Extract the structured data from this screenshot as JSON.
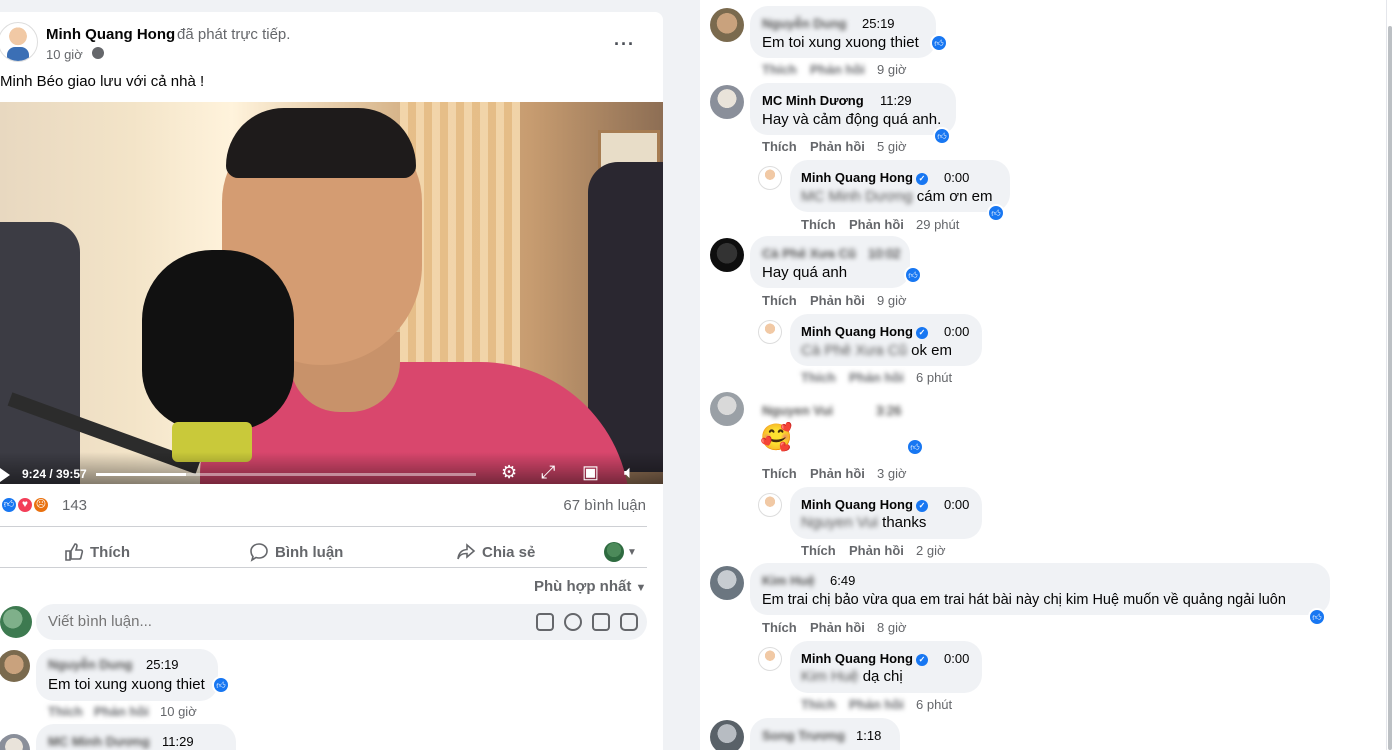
{
  "post": {
    "author": "Minh Quang Hong",
    "action": "đã phát trực tiếp.",
    "time": "10 giờ",
    "text": "Minh Béo giao lưu với cả nhà !",
    "video": {
      "time_label": "9:24 / 39:57",
      "progress": 0.236
    },
    "reactions_count": "143",
    "comments_count": "67 bình luận",
    "actions": {
      "like": "Thích",
      "comment": "Bình luận",
      "share": "Chia sẻ"
    },
    "sort_label": "Phù hợp nhất",
    "composer_placeholder": "Viết bình luận..."
  },
  "left_comments": [
    {
      "name": "Nguyễn Dung",
      "time": "25:19",
      "text": "Em toi xung xuong thiet",
      "like": "Thích",
      "reply": "Phản hồi",
      "age": "10 giờ"
    },
    {
      "name": "MC Minh Dương",
      "time": "11:29"
    }
  ],
  "right_comments": [
    {
      "name": "Nguyễn Dung",
      "time": "25:19",
      "text": "Em toi xung xuong thiet",
      "like": "Thích",
      "reply": "Phản hồi",
      "age": "9 giờ"
    },
    {
      "name": "MC Minh Dương",
      "time": "11:29",
      "text": "Hay và cảm động quá anh.",
      "like": "Thích",
      "reply": "Phản hồi",
      "age": "5 giờ"
    },
    {
      "name": "Minh Quang Hong",
      "time": "0:00",
      "mention": "MC Minh Dương",
      "text": " cám ơn em",
      "like": "Thích",
      "reply": "Phản hồi",
      "age": "29 phút"
    },
    {
      "name": "Cà Phê Xưa Cũ",
      "time": "10:02",
      "text": "Hay quá anh",
      "like": "Thích",
      "reply": "Phản hồi",
      "age": "9 giờ"
    },
    {
      "name": "Minh Quang Hong",
      "time": "0:00",
      "mention": "Cà Phê Xưa Cũ",
      "text": " ok em",
      "like": "Thích",
      "reply": "Phản hồi",
      "age": "6 phút"
    },
    {
      "name": "Nguyen Vui",
      "time": "3:26",
      "text": "🥰",
      "like": "Thích",
      "reply": "Phản hồi",
      "age": "3 giờ"
    },
    {
      "name": "Minh Quang Hong",
      "time": "0:00",
      "mention": "Nguyen Vui",
      "text": " thanks",
      "like": "Thích",
      "reply": "Phản hồi",
      "age": "2 giờ"
    },
    {
      "name": "Kim Huệ",
      "time": "6:49",
      "text": "Em trai chị bảo vừa qua em trai hát bài này chị kim Huệ muốn về quảng ngải luôn",
      "like": "Thích",
      "reply": "Phản hồi",
      "age": "8 giờ"
    },
    {
      "name": "Minh Quang Hong",
      "time": "0:00",
      "mention": "Kim Huệ",
      "text": " dạ chị",
      "like": "Thích",
      "reply": "Phản hồi",
      "age": "6 phút"
    },
    {
      "name": "Song Trương",
      "time": "1:18"
    }
  ],
  "colors": {
    "accent": "#1877f2",
    "bubble": "#f0f2f5",
    "muted": "#65676b",
    "love": "#f33e58",
    "angry": "#e9710f"
  }
}
